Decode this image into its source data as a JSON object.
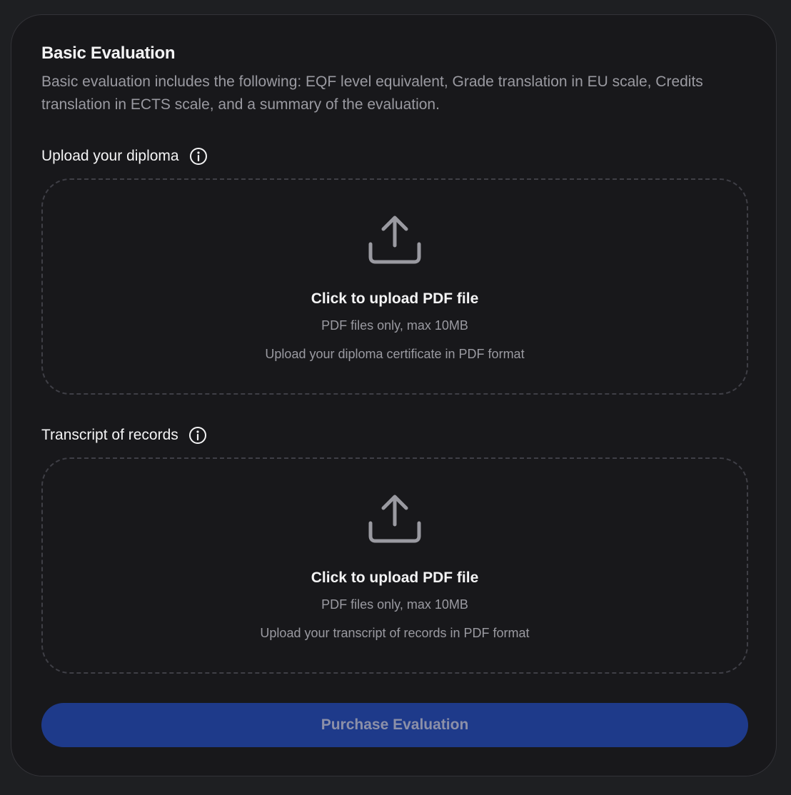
{
  "card": {
    "title": "Basic Evaluation",
    "description": "Basic evaluation includes the following: EQF level equivalent, Grade translation in EU scale, Credits translation in ECTS scale, and a summary of the evaluation."
  },
  "uploads": [
    {
      "label": "Upload your diploma",
      "info_icon": "info-circle-icon",
      "upload_icon": "upload-icon",
      "main_text": "Click to upload PDF file",
      "sub_text": "PDF files only, max 10MB",
      "hint_text": "Upload your diploma certificate in PDF format"
    },
    {
      "label": "Transcript of records",
      "info_icon": "info-circle-icon",
      "upload_icon": "upload-icon",
      "main_text": "Click to upload PDF file",
      "sub_text": "PDF files only, max 10MB",
      "hint_text": "Upload your transcript of records in PDF format"
    }
  ],
  "purchase_button": {
    "label": "Purchase Evaluation",
    "disabled": true
  },
  "colors": {
    "background": "#1e1f22",
    "card": "#18181b",
    "text_primary": "#f4f4f5",
    "text_secondary": "#9a9aa1",
    "button_bg": "#1e3a8a",
    "button_text": "#8c90a8"
  }
}
